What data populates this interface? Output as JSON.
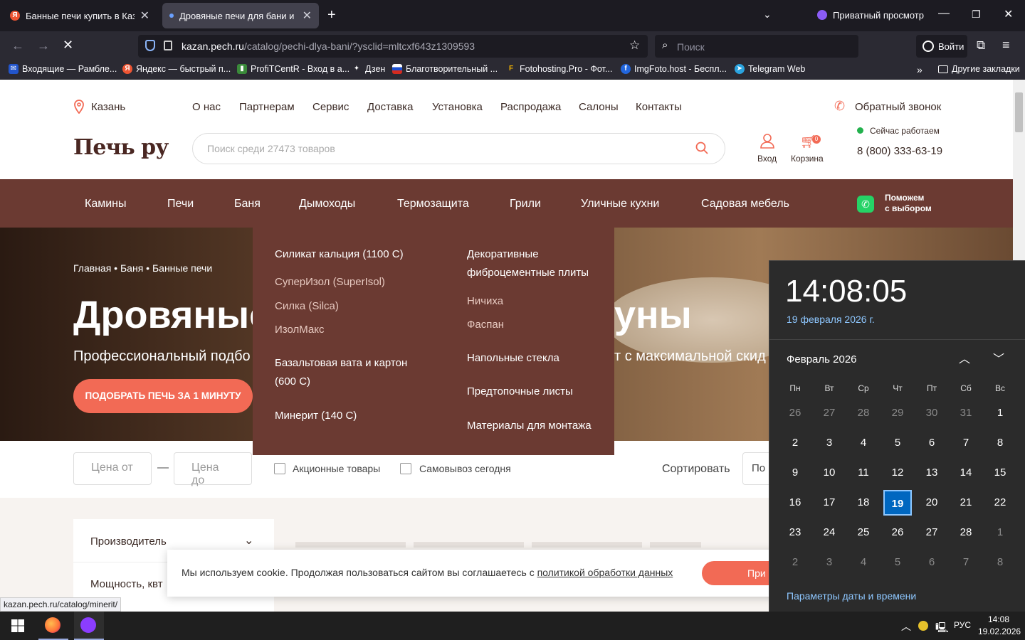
{
  "browser": {
    "tabs": [
      {
        "title": "Банные печи купить в Казани",
        "active": false
      },
      {
        "title": "Дровяные печи для бани и сауны",
        "active": true
      }
    ],
    "private_label": "Приватный просмотр",
    "url_domain": "kazan.pech.ru",
    "url_path": "/catalog/pechi-dlya-bani/?ysclid=mltcxf643z1309593",
    "search_placeholder": "Поиск",
    "login_label": "Войти",
    "bookmarks": [
      "Входящие — Рамбле...",
      "Яндекс — быстрый п...",
      "ProfiTCentR - Вход в а...",
      "Дзен",
      "Благотворительный ...",
      "Fotohosting.Pro - Фот...",
      "ImgFoto.host - Беспл...",
      "Telegram Web"
    ],
    "other_bookmarks": "Другие закладки",
    "status_url": "kazan.pech.ru/catalog/minerit/"
  },
  "site": {
    "city": "Казань",
    "topnav": [
      "О нас",
      "Партнерам",
      "Сервис",
      "Доставка",
      "Установка",
      "Распродажа",
      "Салоны",
      "Контакты"
    ],
    "callback": "Обратный звонок",
    "logo": "Печь ру",
    "search_placeholder": "Поиск среди 27473 товаров",
    "login": "Вход",
    "cart": "Корзина",
    "cart_count": "0",
    "working": "Сейчас работаем",
    "phone": "8 (800) 333-63-19",
    "menu": [
      "Камины",
      "Печи",
      "Баня",
      "Дымоходы",
      "Термозащита",
      "Грили",
      "Уличные кухни",
      "Садовая мебель"
    ],
    "help_line1": "Поможем",
    "help_line2": "с выбором",
    "breadcrumbs": [
      "Главная",
      "Баня",
      "Банные печи"
    ],
    "hero_title_left": "Дровяные",
    "hero_title_right": "уны",
    "hero_sub_left": "Профессиональный подбо",
    "hero_sub_right": "т с максимальной скид",
    "hero_button": "ПОДОБРАТЬ ПЕЧЬ ЗА 1 МИНУТУ",
    "dropdown": {
      "col1": [
        {
          "label": "Силикат кальция (1100 С)",
          "main": true
        },
        {
          "label": "СуперИзол (SuperIsol)",
          "main": false
        },
        {
          "label": "Силка (Silca)",
          "main": false
        },
        {
          "label": "ИзолМакс",
          "main": false
        },
        {
          "label": "Базальтовая вата и картон",
          "main": true
        },
        {
          "label": "(600 С)",
          "main": true
        },
        {
          "label": "Минерит (140 С)",
          "main": true
        }
      ],
      "col2": [
        {
          "label": "Декоративные",
          "main": true
        },
        {
          "label": "фиброцементные плиты",
          "main": true
        },
        {
          "label": "Ничиха",
          "main": false
        },
        {
          "label": "Фаспан",
          "main": false
        },
        {
          "label": "Напольные стекла",
          "main": true
        },
        {
          "label": "Предтопочные листы",
          "main": true
        },
        {
          "label": "Материалы для монтажа",
          "main": true
        }
      ]
    },
    "price_from": "Цена от",
    "price_to": "Цена до",
    "promo": "Акционные товары",
    "pickup": "Самовывоз сегодня",
    "sort": "Сортировать",
    "sort_value": "По",
    "filters": [
      "Производитель",
      "Мощность, квт"
    ],
    "cookie_text": "Мы используем cookie. Продолжая пользоваться сайтом вы соглашаетесь с ",
    "cookie_link": "политикой обработки данных",
    "cookie_button": "При"
  },
  "calendar": {
    "time": "14:08:05",
    "date": "19 февраля 2026 г.",
    "month": "Февраль 2026",
    "weekdays": [
      "Пн",
      "Вт",
      "Ср",
      "Чт",
      "Пт",
      "Сб",
      "Вс"
    ],
    "weeks": [
      [
        "26",
        "27",
        "28",
        "29",
        "30",
        "31",
        "1"
      ],
      [
        "2",
        "3",
        "4",
        "5",
        "6",
        "7",
        "8"
      ],
      [
        "9",
        "10",
        "11",
        "12",
        "13",
        "14",
        "15"
      ],
      [
        "16",
        "17",
        "18",
        "19",
        "20",
        "21",
        "22"
      ],
      [
        "23",
        "24",
        "25",
        "26",
        "27",
        "28",
        "1"
      ],
      [
        "2",
        "3",
        "4",
        "5",
        "6",
        "7",
        "8"
      ]
    ],
    "today": "19",
    "settings": "Параметры даты и времени"
  },
  "taskbar": {
    "lang": "РУС",
    "time": "14:08",
    "date": "19.02.2026"
  },
  "colors": {
    "brand_brown": "#6b3a32",
    "accent_coral": "#f26a55",
    "calendar_today": "#0067c0"
  }
}
